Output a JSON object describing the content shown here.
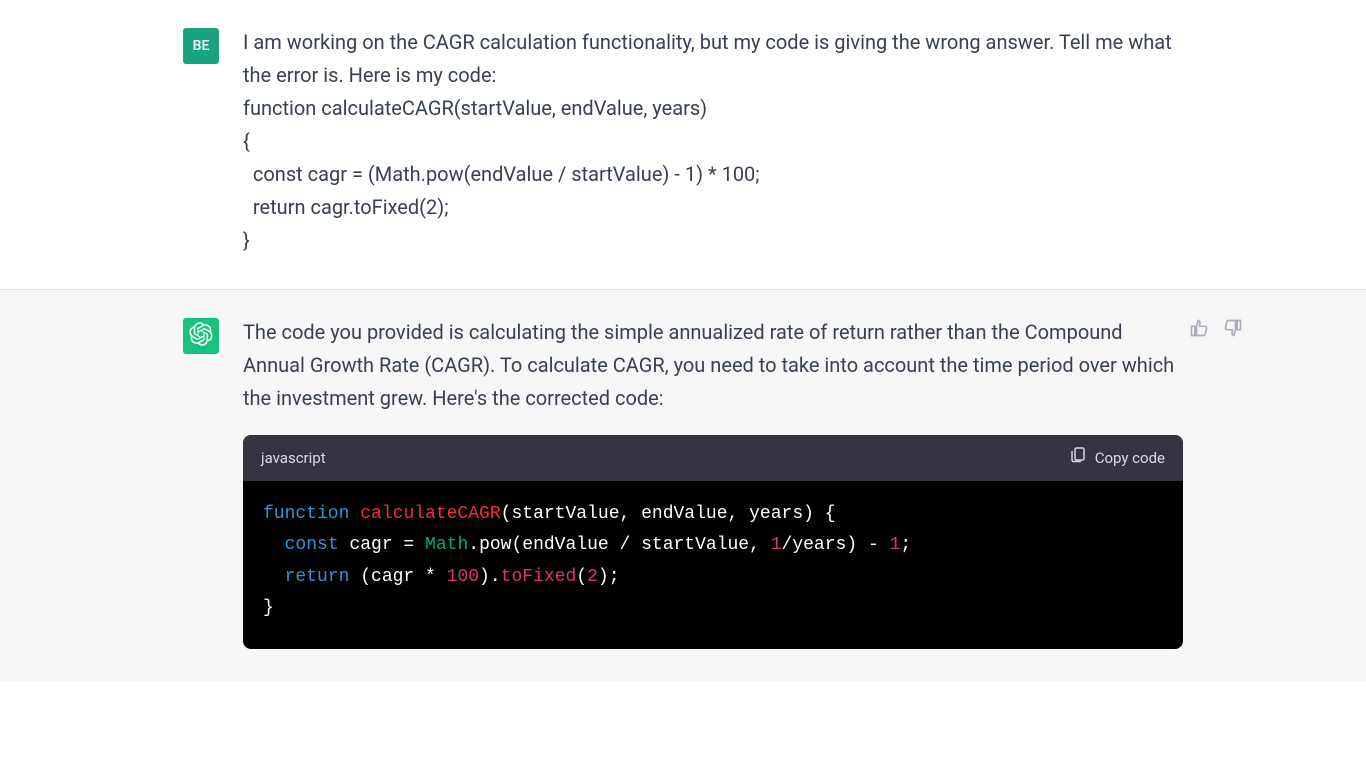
{
  "user": {
    "avatar_initials": "BE",
    "message_intro": "I am working on the CAGR calculation functionality, but my code is giving the wrong answer. Tell me what the error is. Here is my code:",
    "code_line1": "function calculateCAGR(startValue, endValue, years)",
    "code_line2": "{",
    "code_line3": "  const cagr = (Math.pow(endValue / startValue) - 1) * 100;",
    "code_line4": "  return cagr.toFixed(2);",
    "code_line5": "}"
  },
  "assistant": {
    "message": "The code you provided is calculating the simple annualized rate of return rather than the Compound Annual Growth Rate (CAGR). To calculate CAGR, you need to take into account the time period over which the investment grew. Here's the corrected code:",
    "code_lang": "javascript",
    "copy_label": "Copy code",
    "code": {
      "kw_function": "function",
      "fn_name": "calculateCAGR",
      "params": "(startValue, endValue, years) {",
      "kw_const": "const",
      "var_cagr": " cagr = ",
      "builtin_math": "Math",
      "pow_call": ".pow(endValue / startValue, ",
      "num_1": "1",
      "slash_years": "/years) - ",
      "num_1b": "1",
      "semi": ";",
      "kw_return": "return",
      "return_expr": " (cagr * ",
      "num_100": "100",
      "to_fixed_pre": ").",
      "to_fixed": "toFixed",
      "to_fixed_arg_open": "(",
      "num_2": "2",
      "to_fixed_arg_close": ");",
      "close_brace": "}"
    }
  }
}
